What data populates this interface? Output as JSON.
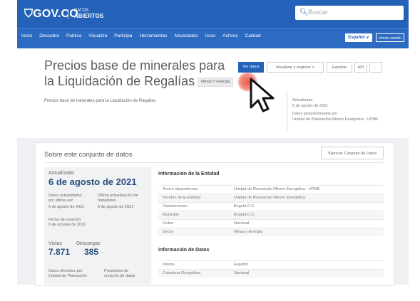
{
  "header": {
    "logo": "GOV.CO",
    "logo2_small": "DATOS",
    "logo2_big": "ABIERTOS",
    "search_placeholder": "Buscar"
  },
  "nav": {
    "items": [
      "Inicio",
      "Descubre",
      "Publica",
      "Visualiza",
      "Participa",
      "Herramientas",
      "Novedades",
      "Usos",
      "Actívos",
      "Calidad"
    ],
    "lang_button": "Español ∨",
    "login_button": "Iniciar sesión"
  },
  "dataset": {
    "title": "Precios base de minerales para la Liquidación de Regalías",
    "tag": "Minas Y Energia",
    "description": "Precios base de minerales para la Liquidación de Regalías",
    "toolbar": {
      "ver_datos": "Ver datos",
      "visualizar": "Visualizar y explorar ∨",
      "exportar": "Exportar",
      "api": "API",
      "more": "···"
    },
    "meta": {
      "updated_label": "Actualizado",
      "updated_value": "6 de agosto de 2021",
      "provided_label": "Datos proporcionados por",
      "provided_value": "Unidad de Planeación Minero Energética - UPME"
    }
  },
  "about": {
    "title": "Sobre este conjunto de datos",
    "follow_button": "Silenciar Conjunto de Datos",
    "updated_label": "Actualizado",
    "updated_value": "6 de agosto de 2021",
    "data_updated_label": "Datos actualizados por última vez",
    "data_updated_value": "6 de agosto de 2021",
    "meta_updated_label": "Última actualización de metadatos",
    "meta_updated_value": "6 de agosto de 2021",
    "created_label": "Fecha de creación",
    "created_value": "6 de octubre de 2016",
    "views_label": "Vistas",
    "views_value": "7.871",
    "downloads_label": "Descargas",
    "downloads_value": "385",
    "by_label": "Datos ofrecidos por",
    "by_value": "Unidad de Planeación",
    "owner_label": "Propietario de",
    "owner_value": "conjunto de datos",
    "entity_heading": "Información de la Entidad",
    "entity_rows": [
      {
        "k": "Área o dependencia",
        "v": "Unidad de Planeación Minero Energética - UPME"
      },
      {
        "k": "Nombre de la Entidad",
        "v": "Unidad de Planeación Minero Energética"
      },
      {
        "k": "Departamento",
        "v": "Bogotá D.C."
      },
      {
        "k": "Municipio",
        "v": "Bogotá D.C."
      },
      {
        "k": "Orden",
        "v": "Nacional"
      },
      {
        "k": "Sector",
        "v": "Minas y Energía"
      }
    ],
    "data_heading": "Información de Datos",
    "data_rows": [
      {
        "k": "Idioma",
        "v": "Español"
      },
      {
        "k": "Cobertura Geográfica",
        "v": "Nacional"
      }
    ]
  }
}
